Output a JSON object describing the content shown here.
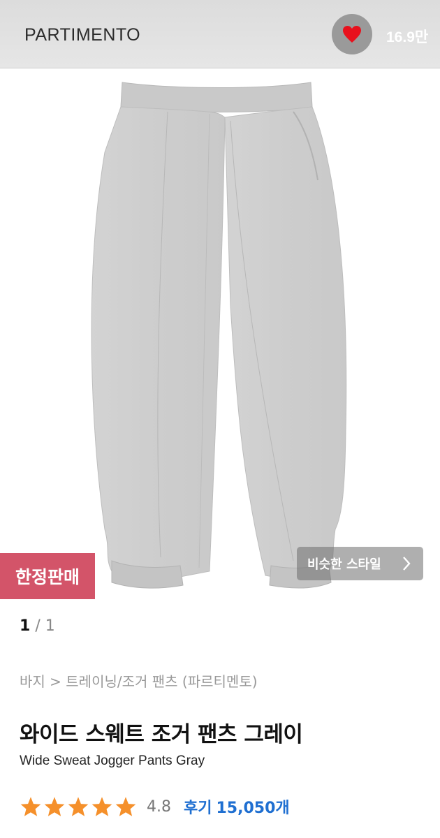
{
  "header": {
    "brand": "PARTIMENTO",
    "like_icon": "heart-icon",
    "like_count": "16.9만",
    "heart_color": "#e8101c"
  },
  "product": {
    "image_icon": "gray-jogger-pants-photo",
    "badge": "한정판매",
    "badge_color": "#d35469",
    "similar_label": "비슷한 스타일",
    "pager": {
      "current": "1",
      "total": "1"
    },
    "breadcrumb": "바지 > 트레이닝/조거 팬츠 (파르티멘토)",
    "title": "와이드 스웨트 조거 팬츠 그레이",
    "subtitle": "Wide Sweat Jogger Pants Gray",
    "rating": "4.8",
    "rating_fraction": 0.96,
    "review_label": "후기",
    "review_count": "15,050개",
    "star_color": "#f5902b",
    "accent_color": "#1f6fd1"
  }
}
